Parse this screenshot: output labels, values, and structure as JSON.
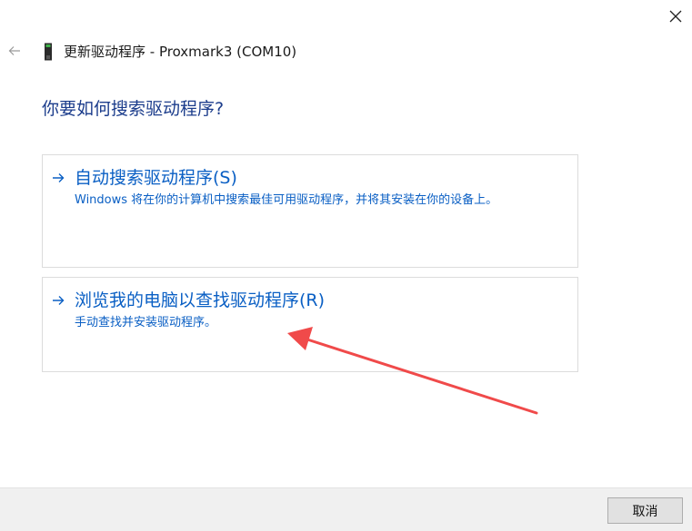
{
  "window": {
    "title": "更新驱动程序 - Proxmark3 (COM10)",
    "close_icon": "close-icon",
    "back_icon": "back-arrow-icon",
    "device_icon": "device-icon"
  },
  "main": {
    "heading": "你要如何搜索驱动程序?",
    "options": [
      {
        "title": "自动搜索驱动程序(S)",
        "description": "Windows 将在你的计算机中搜索最佳可用驱动程序，并将其安装在你的设备上。",
        "icon": "arrow-right-icon"
      },
      {
        "title": "浏览我的电脑以查找驱动程序(R)",
        "description": "手动查找并安装驱动程序。",
        "icon": "arrow-right-icon"
      }
    ]
  },
  "annotation": {
    "color": "#f04a4a",
    "icon": "annotation-arrow-icon"
  },
  "footer": {
    "cancel_label": "取消"
  },
  "colors": {
    "heading": "#1c3d8c",
    "link": "#0a5fc4",
    "card_border": "#dcdcdc",
    "footer_bg": "#f0f0f0"
  }
}
